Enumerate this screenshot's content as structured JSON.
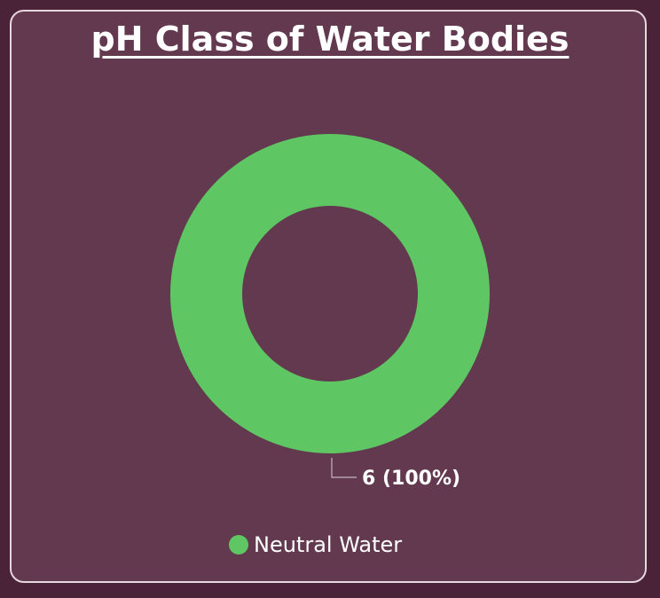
{
  "title": "pH Class of Water Bodies",
  "colors": {
    "slice": "#5ec763",
    "label": "#ffffff",
    "leader": "#c9b5c0"
  },
  "chart_data": {
    "type": "pie",
    "style": "donut",
    "title": "pH Class of Water Bodies",
    "slices": [
      {
        "name": "Neutral Water",
        "value": 6,
        "percent": 100,
        "label": "6 (100%)"
      }
    ],
    "legend": {
      "placement": "bottom",
      "entries": [
        "Neutral Water"
      ]
    }
  }
}
